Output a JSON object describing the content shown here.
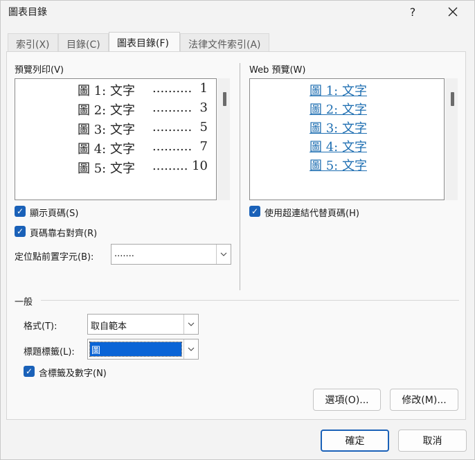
{
  "window": {
    "title": "圖表目錄",
    "help_label": "?",
    "close_label": "✕"
  },
  "tabs": [
    {
      "label": "索引(X)"
    },
    {
      "label": "目錄(C)"
    },
    {
      "label": "圖表目錄(F)"
    },
    {
      "label": "法律文件索引(A)"
    }
  ],
  "print_preview": {
    "label": "預覽列印(V)",
    "lines": [
      {
        "caption": "圖  1:  文字",
        "dots": "..........",
        "page": "1"
      },
      {
        "caption": "圖  2:  文字",
        "dots": "..........",
        "page": "3"
      },
      {
        "caption": "圖  3:  文字",
        "dots": "..........",
        "page": "5"
      },
      {
        "caption": "圖  4:  文字",
        "dots": "..........",
        "page": "7"
      },
      {
        "caption": "圖  5:  文字",
        "dots": ".........",
        "page": "10"
      }
    ]
  },
  "web_preview": {
    "label": "Web 預覽(W)",
    "lines": [
      "圖  1:  文字",
      "圖  2:  文字",
      "圖  3:  文字",
      "圖  4:  文字",
      "圖  5:  文字"
    ]
  },
  "options": {
    "show_page_numbers": {
      "label": "顯示頁碼(S)",
      "checked": true
    },
    "right_align": {
      "label": "頁碼靠右對齊(R)",
      "checked": true
    },
    "hyperlinks": {
      "label": "使用超連結代替頁碼(H)",
      "checked": true
    },
    "tab_leader": {
      "label": "定位點前置字元(B):",
      "value": "......."
    }
  },
  "general": {
    "heading": "一般",
    "format": {
      "label": "格式(T):",
      "value": "取自範本"
    },
    "caption_label": {
      "label": "標題標籤(L):",
      "value": "圖"
    },
    "include_label": {
      "label": "含標籤及數字(N)",
      "checked": true
    }
  },
  "buttons": {
    "options": "選項(O)...",
    "modify": "修改(M)...",
    "ok": "確定",
    "cancel": "取消"
  },
  "icons": {
    "check": "✓",
    "dropdown": "∨"
  }
}
